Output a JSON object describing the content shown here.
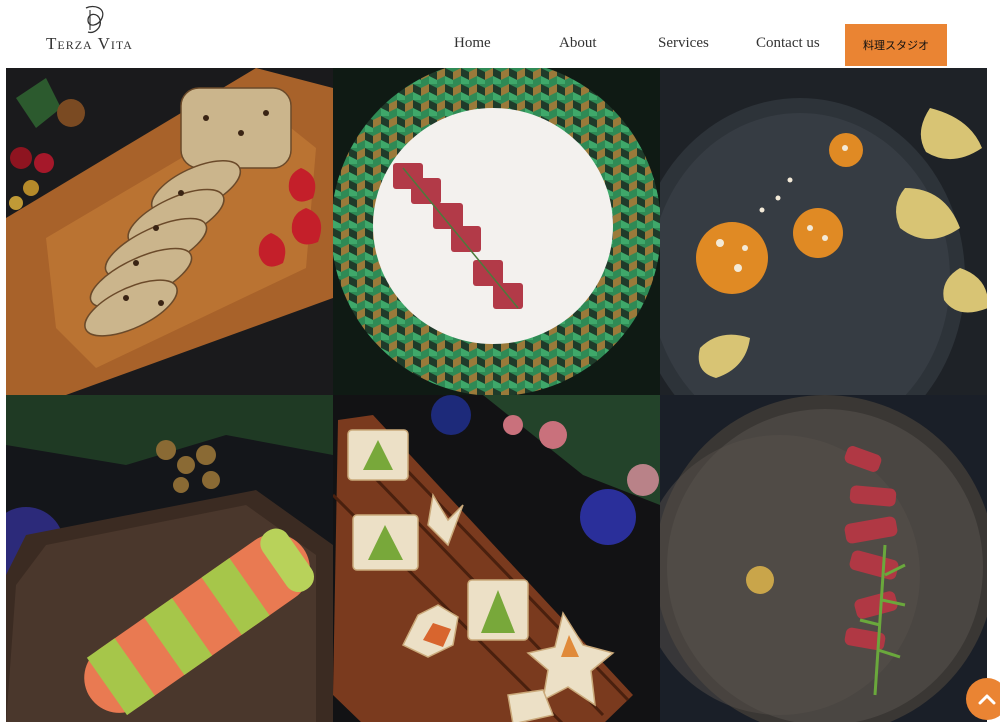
{
  "brand": {
    "name": "Terza Vita"
  },
  "nav": {
    "items": [
      {
        "label": "Home"
      },
      {
        "label": "About"
      },
      {
        "label": "Services"
      },
      {
        "label": "Contact us"
      }
    ],
    "cta_label": "料理スタジオ"
  },
  "gallery": {
    "items": [
      {
        "subject": "fruit-cake-on-wooden-board"
      },
      {
        "subject": "tuna-on-geometric-plate"
      },
      {
        "subject": "pumpkin-rounds-on-dark-plate"
      },
      {
        "subject": "salmon-avocado-roll"
      },
      {
        "subject": "christmas-tree-sandwiches"
      },
      {
        "subject": "sliced-beef-on-dark-plate"
      }
    ]
  },
  "colors": {
    "accent": "#ea8433",
    "text": "#333333",
    "background": "#ffffff"
  },
  "icons": {
    "scroll_top": "chevron-up-icon"
  }
}
